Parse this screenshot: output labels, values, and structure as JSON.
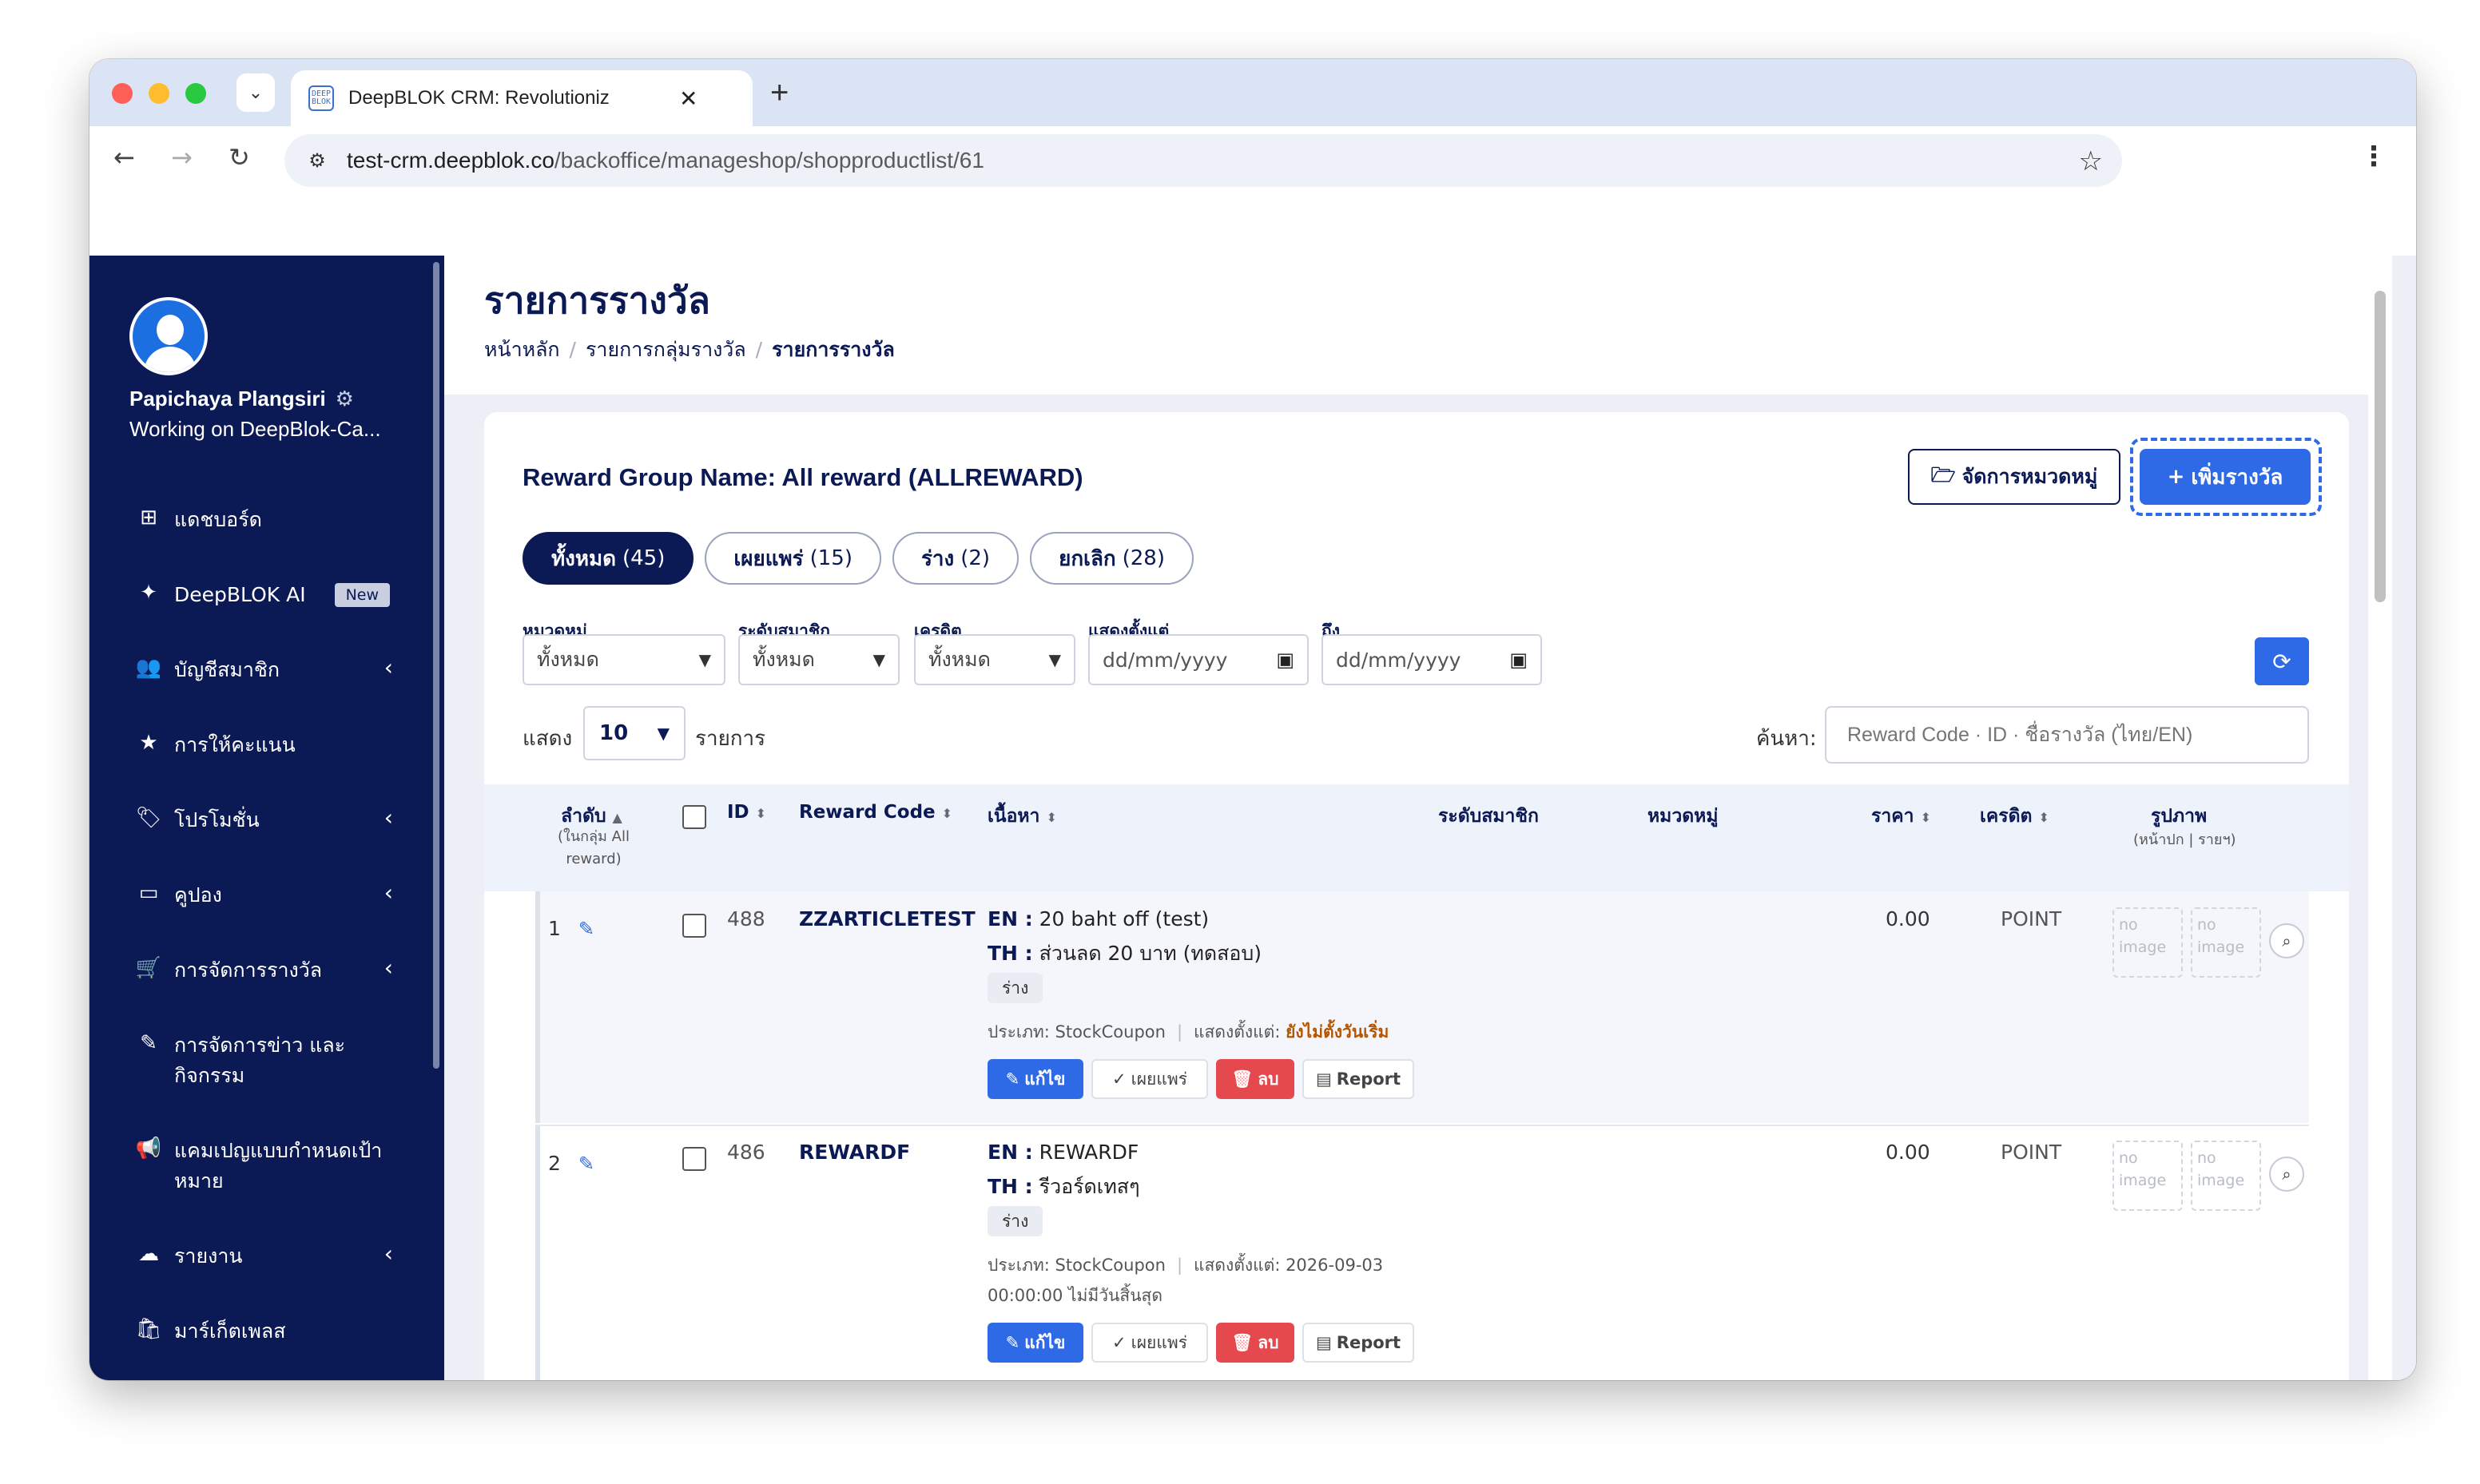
{
  "browser": {
    "tab_title": "DeepBLOK CRM: Revolutioniz",
    "tab_favicon_text": "DEEP BLOK",
    "url_domain": "test-crm.deepblok.co",
    "url_path": "/backoffice/manageshop/shopproductlist/61"
  },
  "user": {
    "name": "Papichaya Plangsiri",
    "workspace": "Working on DeepBlok-Ca..."
  },
  "sidebar": {
    "items": [
      {
        "label": "แดชบอร์ด",
        "icon": "dashboard-icon"
      },
      {
        "label": "DeepBLOK AI",
        "icon": "sparkle-icon",
        "badge": "New"
      },
      {
        "label": "บัญชีสมาชิก",
        "icon": "users-icon"
      },
      {
        "label": "การให้คะแนน",
        "icon": "star-icon"
      },
      {
        "label": "โปรโมชั่น",
        "icon": "tag-icon"
      },
      {
        "label": "คูปอง",
        "icon": "ticket-icon"
      },
      {
        "label": "การจัดการรางวัล",
        "icon": "cart-icon"
      },
      {
        "label": "การจัดการข่าว และกิจกรรม",
        "icon": "edit-icon"
      },
      {
        "label": "แคมเปญแบบกำหนดเป้าหมาย",
        "icon": "megaphone-icon"
      },
      {
        "label": "รายงาน",
        "icon": "cloud-download-icon"
      },
      {
        "label": "มาร์เก็ตเพลส",
        "icon": "bag-icon"
      }
    ]
  },
  "header": {
    "title": "รายการรางวัล",
    "breadcrumb": [
      "หน้าหลัก",
      "รายการกลุ่มรางวัล",
      "รายการรางวัล"
    ]
  },
  "card": {
    "group_name": "Reward Group Name: All reward (ALLREWARD)",
    "manage_button": "จัดการหมวดหมู่",
    "add_button": "เพิ่มรางวัล"
  },
  "status_tabs": [
    {
      "label": "ทั้งหมด",
      "count": "(45)",
      "active": true
    },
    {
      "label": "เผยแพร่",
      "count": "(15)",
      "active": false
    },
    {
      "label": "ร่าง",
      "count": "(2)",
      "active": false
    },
    {
      "label": "ยกเลิก",
      "count": "(28)",
      "active": false
    }
  ],
  "filters": {
    "category_label": "หมวดหมู่",
    "category_value": "ทั้งหมด",
    "tier_label": "ระดับสมาชิก",
    "tier_value": "ทั้งหมด",
    "credit_label": "เครดิต",
    "credit_value": "ทั้งหมด",
    "show_from_label": "แสดงตั้งแต่",
    "show_from_placeholder": "dd/mm/yyyy",
    "to_label": "ถึง",
    "to_placeholder": "dd/mm/yyyy"
  },
  "list_controls": {
    "show_label": "แสดง",
    "page_size": "10",
    "items_label": "รายการ",
    "search_label": "ค้นหา:",
    "search_placeholder": "Reward Code · ID · ชื่อรางวัล (ไทย/EN)"
  },
  "table": {
    "headers": {
      "order": "ลำดับ",
      "order_sub": "(ในกลุ่ม All reward)",
      "id": "ID",
      "code": "Reward Code",
      "content": "เนื้อหา",
      "tier": "ระดับสมาชิก",
      "category": "หมวดหมู่",
      "price": "ราคา",
      "credit": "เครดิต",
      "image": "รูปภาพ",
      "image_sub": "(หน้าปก | รายฯ)"
    },
    "rows": [
      {
        "order": "1",
        "id": "488",
        "code": "ZZARTICLETEST",
        "en_label": "EN :",
        "en": "20 baht off (test)",
        "th_label": "TH :",
        "th": "ส่วนลด 20 บาท (ทดสอบ)",
        "status": "ร่าง",
        "type": "ประเภท: StockCoupon",
        "show_from_label": "แสดงตั้งแต่:",
        "show_from_value": "ยังไม่ตั้งวันเริ่ม",
        "price": "0.00",
        "credit": "POINT",
        "no_image": "no image"
      },
      {
        "order": "2",
        "id": "486",
        "code": "REWARDF",
        "en_label": "EN :",
        "en": "REWARDF",
        "th_label": "TH :",
        "th": "รีวอร์ดเทสๆ",
        "status": "ร่าง",
        "type": "ประเภท: StockCoupon",
        "show_from_label": "แสดงตั้งแต่: 2026-09-03",
        "show_from_value": "00:00:00 ไม่มีวันสิ้นสุด",
        "price": "0.00",
        "credit": "POINT",
        "no_image": "no image"
      }
    ],
    "actions": {
      "edit": "แก้ไข",
      "publish": "เผยแพร่",
      "delete": "ลบ",
      "report": "Report"
    }
  }
}
